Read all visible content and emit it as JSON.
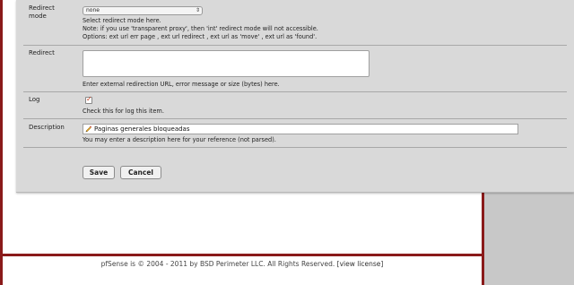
{
  "form": {
    "redirect_mode": {
      "label": "Redirect\nmode",
      "selected": "none",
      "help_line1": "Select redirect mode here.",
      "help_line2": "Note: if you use 'transparent proxy', then 'int' redirect mode will not accessible.",
      "help_line3": "Options: ext url err page , ext url redirect , ext url as 'move' , ext url as 'found'."
    },
    "redirect": {
      "label": "Redirect",
      "value": "",
      "help": "Enter external redirection URL, error message or size (bytes) here."
    },
    "log": {
      "label": "Log",
      "checked": true,
      "help": "Check this for log this item."
    },
    "description": {
      "label": "Description",
      "value": "Paginas generales bloqueadas",
      "help": "You may enter a description here for your reference (not parsed)."
    },
    "buttons": {
      "save": "Save",
      "cancel": "Cancel"
    }
  },
  "footer": {
    "copyright": "pfSense is © 2004 - 2011 by BSD Perimeter LLC. All Rights Reserved.",
    "license_link": "[view license]"
  },
  "colors": {
    "frame_border": "#8a1a1a",
    "panel_bg": "#d9d9d9",
    "page_bg": "#c8c8c8"
  }
}
